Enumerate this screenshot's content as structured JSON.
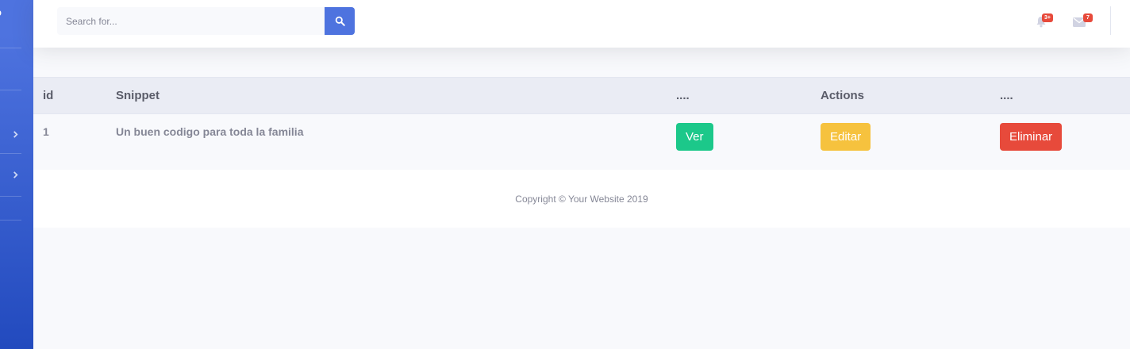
{
  "colors": {
    "primary": "#4e73df",
    "success": "#1cc88a",
    "warning": "#f6c23e",
    "danger": "#e74a3b"
  },
  "sidebar": {
    "brand_glyph": "o",
    "items": [
      {
        "icon": "chevron-right-icon"
      },
      {
        "icon": "chevron-right-icon"
      }
    ]
  },
  "topbar": {
    "search": {
      "placeholder": "Search for...",
      "button_icon": "search-icon"
    },
    "alerts": {
      "icon": "bell-icon",
      "count": "3+"
    },
    "messages": {
      "icon": "envelope-icon",
      "count": "7"
    }
  },
  "table": {
    "headers": [
      "id",
      "Snippet",
      "....",
      "Actions",
      "...."
    ],
    "rows": [
      {
        "id": "1",
        "snippet": "Un buen codigo para toda la familia",
        "view_label": "Ver",
        "edit_label": "Editar",
        "delete_label": "Eliminar"
      }
    ]
  },
  "footer": {
    "copyright": "Copyright © Your Website 2019"
  }
}
